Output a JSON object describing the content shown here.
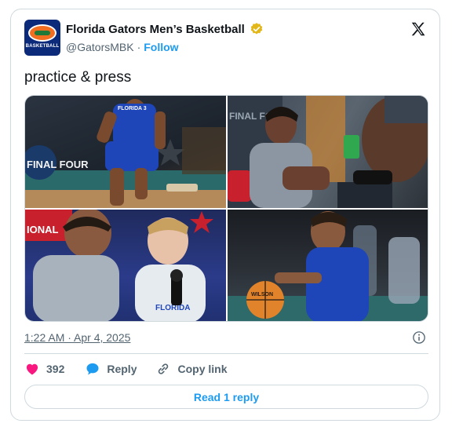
{
  "author": {
    "display_name": "Florida Gators Men’s Basketball",
    "handle": "@GatorsMBK",
    "separator": "·",
    "follow_label": "Follow",
    "avatar_text": "BASKETBALL"
  },
  "tweet": {
    "text": "practice & press",
    "timestamp": "1:22 AM · Apr 4, 2025"
  },
  "media": {
    "photo_1_text": "FINAL FOUR",
    "photo_1_jersey": "FLORIDA 3",
    "photo_2_text": "FINAL FO",
    "photo_3_text": "IONAL",
    "photo_3_jersey": "FLORIDA",
    "photo_4_ball": "WILSON"
  },
  "actions": {
    "like_count": "392",
    "reply_label": "Reply",
    "copy_link_label": "Copy link"
  },
  "read_reply_label": "Read 1 reply",
  "colors": {
    "accent": "#1d9bf0",
    "like": "#f91880",
    "verified": "#e2b719",
    "border": "#cfd9de",
    "muted": "#536471"
  }
}
